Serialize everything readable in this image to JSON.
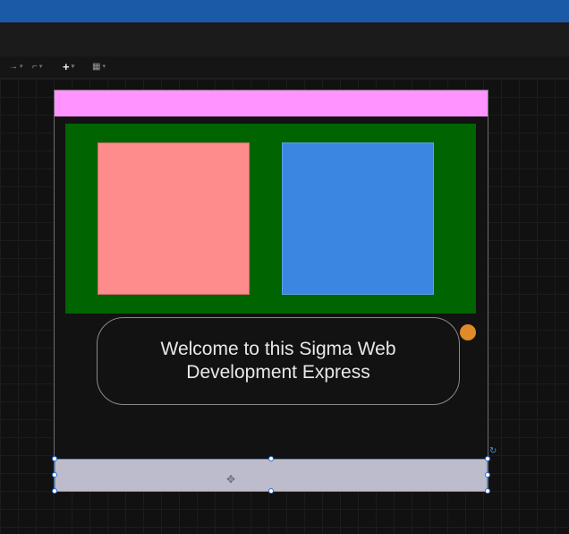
{
  "toolbar": {
    "items": [
      {
        "name": "connector-arrow-tool",
        "glyph": "→",
        "caret": "▾"
      },
      {
        "name": "elbow-connector-tool",
        "glyph": "⌐",
        "caret": "▾"
      },
      {
        "name": "add-tool",
        "glyph": "+",
        "caret": "▾"
      },
      {
        "name": "table-tool",
        "glyph": "▦",
        "caret": "▾"
      }
    ]
  },
  "canvas": {
    "welcome_text": "Welcome to this Sigma Web Development Express",
    "move_glyph": "✥",
    "rotate_glyph": "↻"
  },
  "colors": {
    "title_bar": "#1a5aa6",
    "header_bar": "#ff93ff",
    "green_box": "#006400",
    "pink_box": "#ff8c8c",
    "blue_box": "#3a86e0",
    "orange_dot": "#e08a2a",
    "footer_bar": "#bcbccc",
    "selection": "#4a90e2"
  }
}
